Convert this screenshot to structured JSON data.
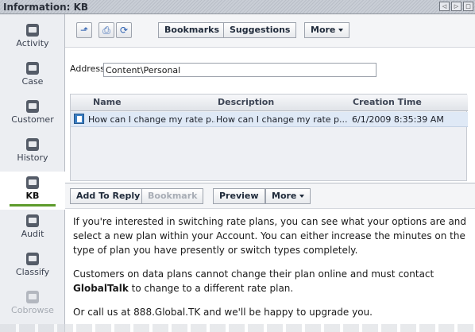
{
  "titlebar": {
    "title": "Information: KB"
  },
  "sidebar": {
    "items": [
      {
        "label": "Activity",
        "icon": "activity-icon"
      },
      {
        "label": "Case",
        "icon": "case-icon"
      },
      {
        "label": "Customer",
        "icon": "customer-icon"
      },
      {
        "label": "History",
        "icon": "history-icon"
      },
      {
        "label": "KB",
        "icon": "kb-icon",
        "active": true
      },
      {
        "label": "Audit",
        "icon": "audit-icon"
      },
      {
        "label": "Classify",
        "icon": "classify-icon"
      },
      {
        "label": "Cobrowse",
        "icon": "cobrowse-icon",
        "disabled": true
      }
    ]
  },
  "toolbar": {
    "bookmarks_label": "Bookmarks",
    "suggestions_label": "Suggestions",
    "more_label": "More"
  },
  "address": {
    "label": "Address",
    "value": "Content\\Personal"
  },
  "grid": {
    "columns": [
      "Name",
      "Description",
      "Creation Time"
    ],
    "rows": [
      {
        "name": "How can I change my rate p...",
        "description": "How can I change my rate p...",
        "created": "6/1/2009 8:35:39 AM"
      }
    ]
  },
  "toolbar2": {
    "add_to_reply_label": "Add To Reply",
    "bookmark_label": "Bookmark",
    "preview_label": "Preview",
    "more_label": "More"
  },
  "article": {
    "p1": "If you're interested in switching rate plans, you can see what your options are and select a new plan within your Account. You can either increase the minutes on the type of plan you have presently or switch types completely.",
    "p2_pre": "Customers on data plans cannot change their plan online and must contact ",
    "p2_bold": "GlobalTalk",
    "p2_post": " to change to a different rate plan.",
    "p3": "Or call us at 888.Global.TK and we'll be happy to upgrade you."
  },
  "colors": {
    "accent": "#5d9b2b",
    "selected_row": "#dfe9f6"
  }
}
